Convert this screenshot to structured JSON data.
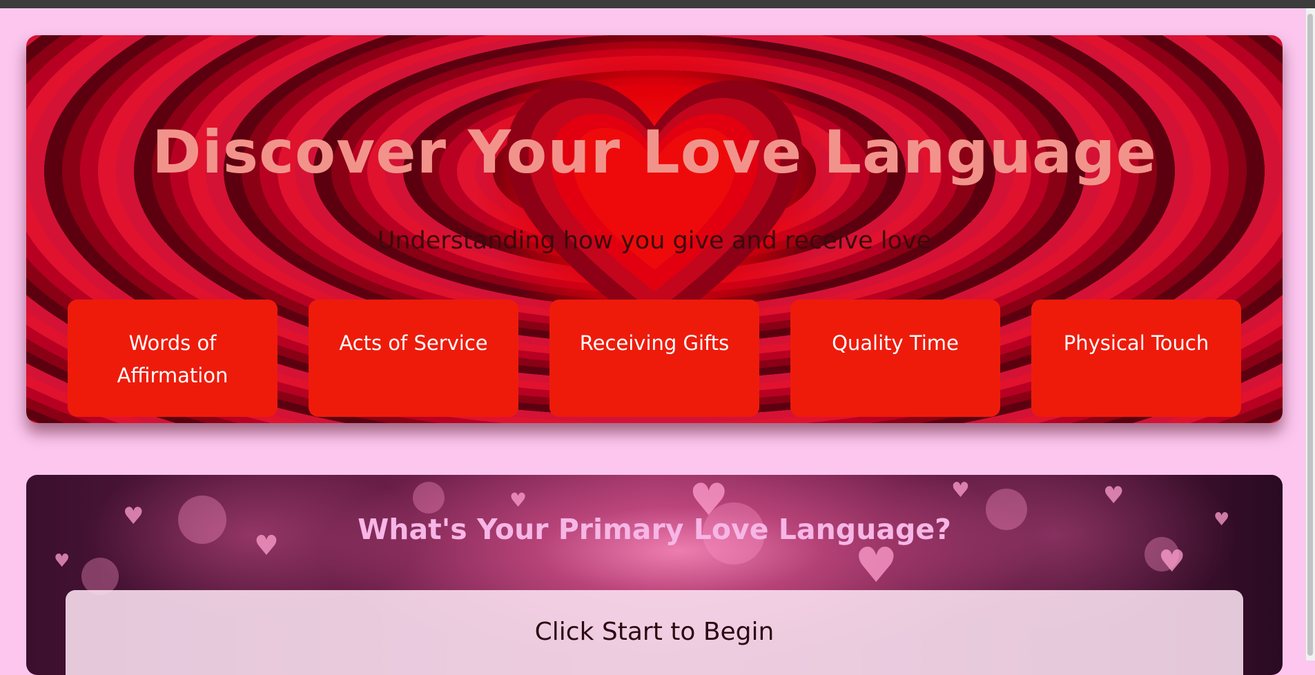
{
  "hero": {
    "title": "Discover Your Love Language",
    "subtitle": "Understanding how you give and receive love",
    "languages": [
      {
        "label": "Words of Affirmation"
      },
      {
        "label": "Acts of Service"
      },
      {
        "label": "Receiving Gifts"
      },
      {
        "label": "Quality Time"
      },
      {
        "label": "Physical Touch"
      }
    ]
  },
  "quiz": {
    "title": "What's Your Primary Love Language?",
    "prompt": "Click Start to Begin"
  },
  "colors": {
    "page_background": "#fcc6ef",
    "hero_title": "#f2938b",
    "card_background": "#ee1b0b",
    "quiz_title": "#f6b6e6"
  }
}
